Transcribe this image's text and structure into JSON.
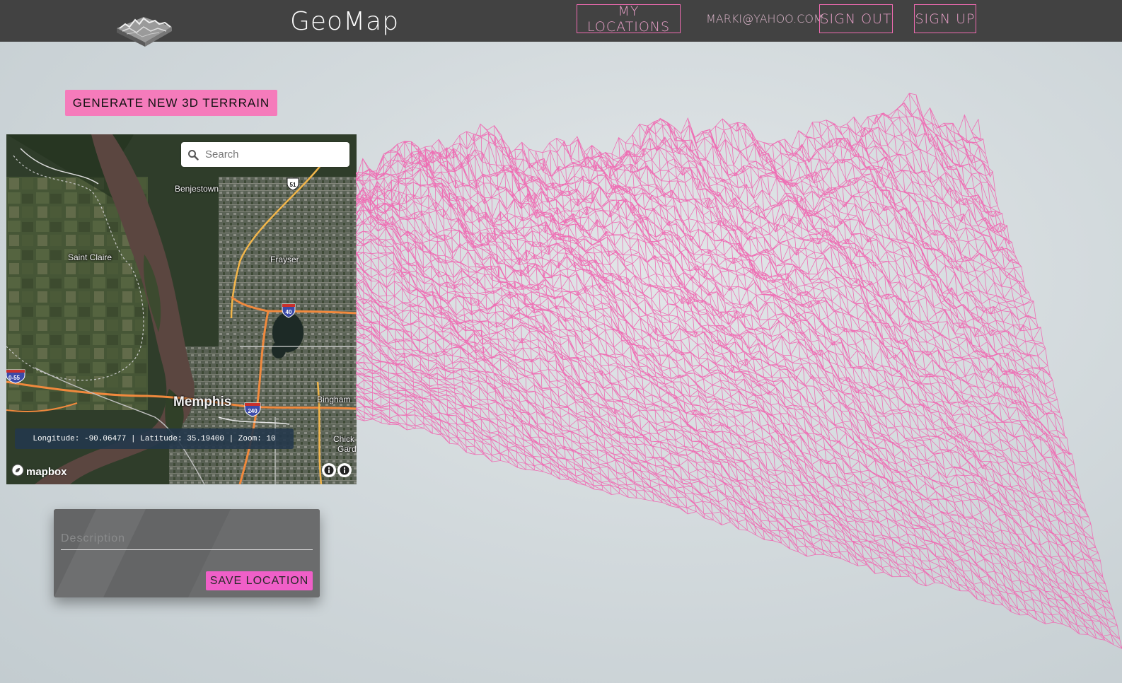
{
  "header": {
    "brand": "GeoMap",
    "nav": {
      "my_locations": "MY LOCATIONS",
      "email": "MARKI@YAHOO.COM",
      "sign_out": "SIGN OUT",
      "sign_up": "SIGN UP"
    }
  },
  "generate_button": "GENERATE NEW 3D TERRRAIN",
  "map": {
    "search_placeholder": "Search",
    "places": {
      "benjestown": "Benjestown",
      "saint_claire": "Saint Claire",
      "frayser": "Frayser",
      "memphis": "Memphis",
      "binghampton": "Bingham",
      "chick": "Chick",
      "gard": "Gard"
    },
    "road_shields": {
      "us51": "51",
      "i40": "40",
      "i240": "240",
      "i55": "0-55"
    },
    "coords_text": "Longitude: -90.06477 | Latitude: 35.19400 | Zoom: 10",
    "attribution": "mapbox"
  },
  "save_card": {
    "description_placeholder": "Description",
    "save_label": "SAVE LOCATION"
  },
  "colors": {
    "header_bg": "#424242",
    "accent_pink": "#f57bbb",
    "wire_pink": "#ee6fb4",
    "save_pink": "#f05fc8"
  }
}
